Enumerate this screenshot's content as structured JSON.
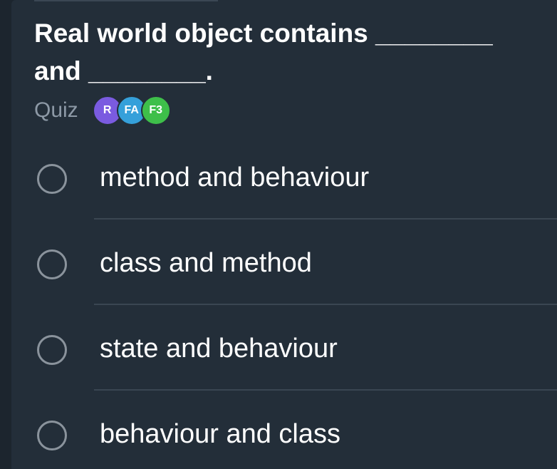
{
  "question": {
    "line1": "Real world object contains ________",
    "line2": "and ________."
  },
  "quiz": {
    "label": "Quiz",
    "avatars": [
      {
        "text": "R",
        "color": "#7a5be0"
      },
      {
        "text": "FA",
        "color": "#35a0da"
      },
      {
        "text": "F3",
        "color": "#3ebf4a"
      }
    ]
  },
  "options": [
    {
      "label": "method and behaviour"
    },
    {
      "label": "class and method"
    },
    {
      "label": "state and behaviour"
    },
    {
      "label": "behaviour and class"
    }
  ],
  "colors": {
    "background": "#232e39",
    "text": "#ffffff",
    "muted": "#8d99a6"
  }
}
